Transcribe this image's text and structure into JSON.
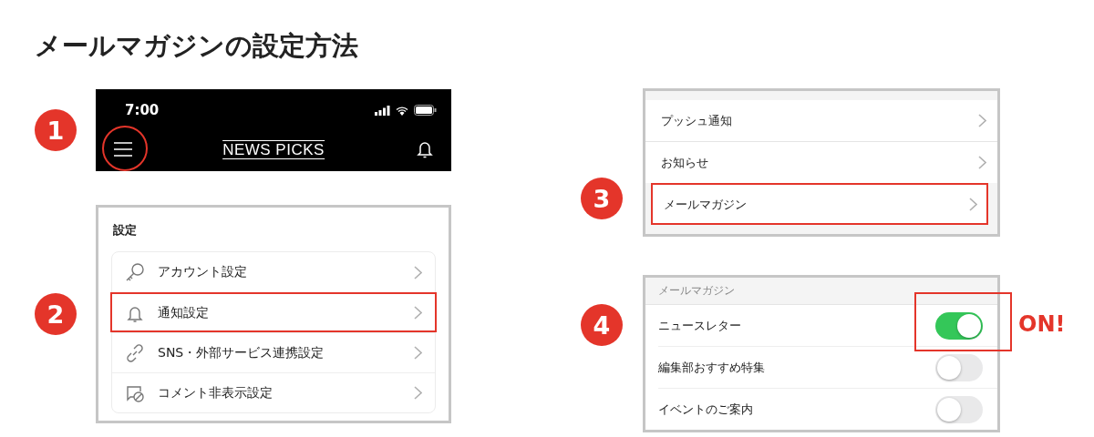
{
  "title": "メールマガジンの設定方法",
  "steps": [
    {
      "number": "1",
      "kind": "app-header",
      "time": "7:00",
      "logo": "NEWS PICKS",
      "menu_highlighted": true
    },
    {
      "number": "2",
      "kind": "settings-menu",
      "heading": "設定",
      "items": [
        {
          "label": "アカウント設定",
          "kind": "key",
          "highlighted": false
        },
        {
          "label": "通知設定",
          "kind": "bell",
          "highlighted": true
        },
        {
          "label": "SNS・外部サービス連携設定",
          "kind": "link",
          "highlighted": false
        },
        {
          "label": "コメント非表示設定",
          "kind": "comment-hidden",
          "highlighted": false
        }
      ]
    },
    {
      "number": "3",
      "kind": "notification-menu",
      "items": [
        {
          "label": "プッシュ通知",
          "highlighted": false
        },
        {
          "label": "お知らせ",
          "highlighted": false
        },
        {
          "label": "メールマガジン",
          "highlighted": true
        }
      ]
    },
    {
      "number": "4",
      "kind": "toggle-list",
      "heading": "メールマガジン",
      "callout": "ON!",
      "items": [
        {
          "label": "ニュースレター",
          "on": true,
          "highlighted": true
        },
        {
          "label": "編集部おすすめ特集",
          "on": false,
          "highlighted": false
        },
        {
          "label": "イベントのご案内",
          "on": false,
          "highlighted": false
        }
      ]
    }
  ]
}
